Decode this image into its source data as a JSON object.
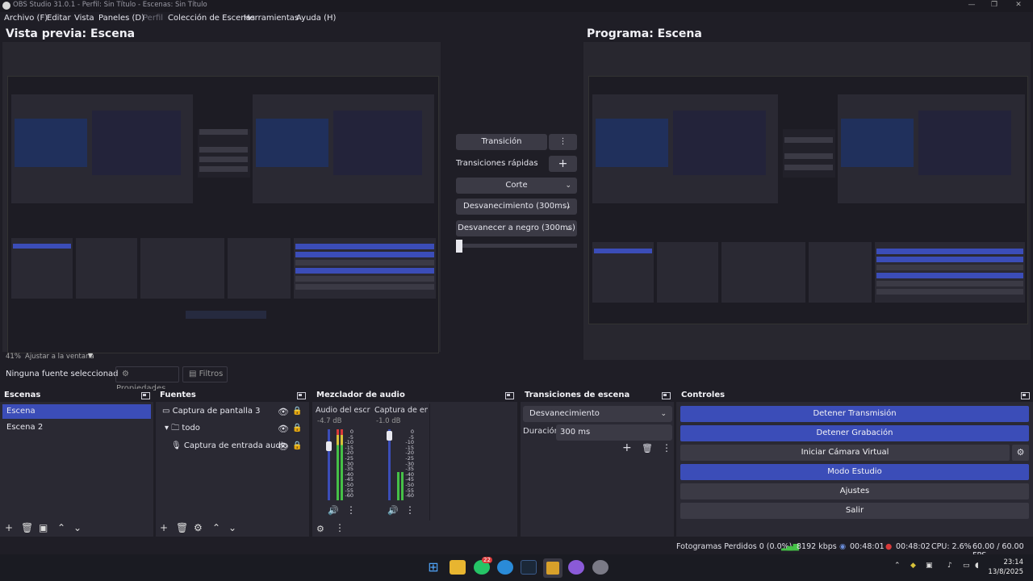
{
  "window": {
    "title": "OBS Studio 31.0.1 - Perfil: Sin Título - Escenas: Sin Título"
  },
  "menu": [
    "Archivo (F)",
    "Editar",
    "Vista",
    "Paneles (D)",
    "Perfil",
    "Colección de Escenas",
    "Herramientas",
    "Ayuda (H)"
  ],
  "preview": {
    "label": "Vista previa: Escena",
    "zoom": "41%",
    "fit": "Ajustar a la ventana"
  },
  "program": {
    "label": "Programa: Escena"
  },
  "transition_col": {
    "transition_button": "Transición",
    "quick_label": "Transiciones rápidas",
    "cut": "Corte",
    "fade": "Desvanecimiento (300ms)",
    "fade_black": "Desvanecer a negro (300ms)"
  },
  "source_bar": {
    "none_selected": "Ninguna fuente seleccionad",
    "properties": "Propiedades",
    "filters": "Filtros"
  },
  "scenes": {
    "title": "Escenas",
    "items": [
      "Escena",
      "Escena 2"
    ]
  },
  "sources": {
    "title": "Fuentes",
    "items": [
      "Captura de pantalla 3",
      "todo",
      "Captura de entrada audio"
    ]
  },
  "mixer": {
    "title": "Mezclador de audio",
    "channels": [
      {
        "name": "Audio del escrito",
        "db": "-4.7 dB"
      },
      {
        "name": "Captura de entra",
        "db": "-1.0 dB"
      }
    ],
    "scale": [
      "0",
      "-5",
      "-10",
      "-15",
      "-20",
      "-25",
      "-30",
      "-35",
      "-40",
      "-45",
      "-50",
      "-55",
      "-60"
    ]
  },
  "scene_transitions": {
    "title": "Transiciones de escena",
    "selected": "Desvanecimiento",
    "duration_label": "Duración",
    "duration_value": "300 ms"
  },
  "controls": {
    "title": "Controles",
    "stop_stream": "Detener Transmisión",
    "stop_record": "Detener Grabación",
    "virtual_cam": "Iniciar Cámara Virtual",
    "studio_mode": "Modo Estudio",
    "settings": "Ajustes",
    "exit": "Salir"
  },
  "status": {
    "dropped": "Fotogramas Perdidos 0 (0.0%)",
    "kbps": "8192 kbps",
    "stream_time": "00:48:01",
    "rec_time": "00:48:02",
    "cpu": "CPU: 2.6%",
    "fps": "60.00 / 60.00 FPS"
  },
  "taskbar": {
    "time": "23:14",
    "date": "13/8/2025",
    "whatsapp_badge": "22"
  },
  "colors": {
    "accent": "#3b4db8",
    "background": "#1f1e26",
    "panel": "#2a2933",
    "button": "#3b3a45",
    "rec_red": "#d83a3a",
    "signal_green": "#45c147"
  }
}
